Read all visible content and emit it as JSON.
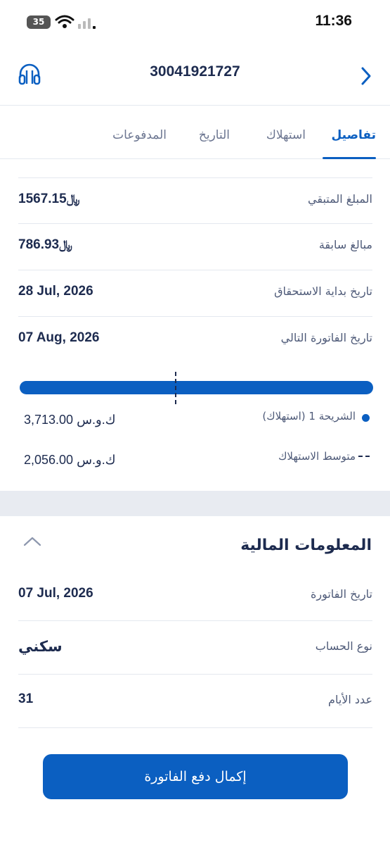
{
  "status_bar": {
    "battery": "35",
    "time": "11:36"
  },
  "header": {
    "account_number": "30041921727"
  },
  "tabs": [
    {
      "label": "تفاصيل",
      "active": true
    },
    {
      "label": "استهلاك",
      "active": false
    },
    {
      "label": "التاريخ",
      "active": false
    },
    {
      "label": "المدفوعات",
      "active": false
    }
  ],
  "details": [
    {
      "label": "المبلغ المتبقي",
      "value": "1567.15",
      "currency_symbol": "﷼"
    },
    {
      "label": "مبالغ سابقة",
      "value": "786.93",
      "currency_symbol": "﷼"
    },
    {
      "label": "تاريخ بداية الاستحقاق",
      "value": "28 Jul, 2026"
    },
    {
      "label": "تاريخ الفاتورة التالي",
      "value": "07 Aug, 2026"
    }
  ],
  "consumption": {
    "bar_color": "#0b5fc1",
    "tier": {
      "label": "الشريحة 1 (استهلاك)",
      "value": "3,713.00 ك.و.س"
    },
    "average": {
      "label": "متوسط الاستهلاك",
      "value": "2,056.00 ك.و.س"
    }
  },
  "financial": {
    "title": "المعلومات المالية",
    "rows": [
      {
        "label": "تاريخ الفاتورة",
        "value": "07 Jul, 2026"
      },
      {
        "label": "نوع الحساب",
        "value": "سكني"
      },
      {
        "label": "عدد الأيام",
        "value": "31"
      }
    ]
  },
  "actions": {
    "pay_label": "إكمال دفع الفاتورة"
  },
  "colors": {
    "accent": "#0b5fc1",
    "text": "#1d2b4f",
    "muted": "#4e5a78",
    "divider": "#e4e8ef"
  }
}
